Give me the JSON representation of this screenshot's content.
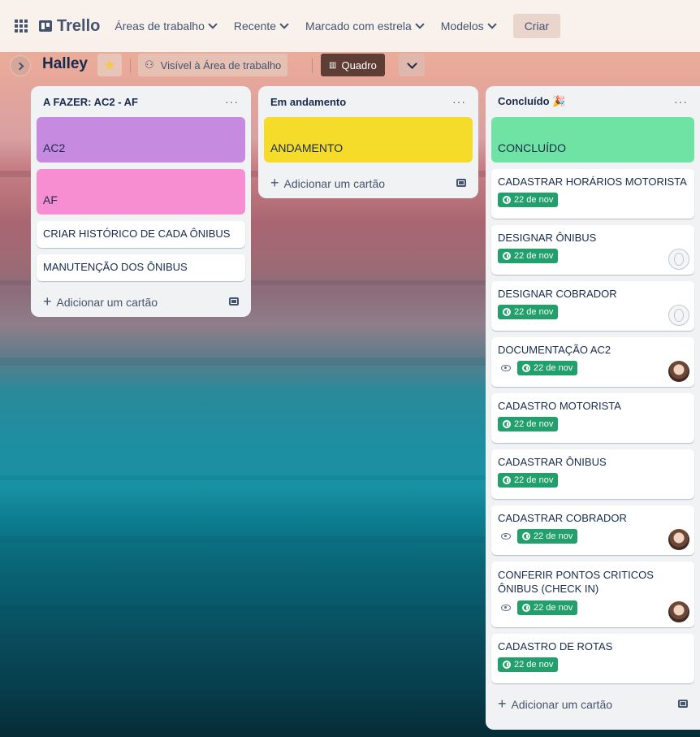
{
  "topbar": {
    "logo": "Trello",
    "nav": [
      "Áreas de trabalho",
      "Recente",
      "Marcado com estrela",
      "Modelos"
    ],
    "create_label": "Criar"
  },
  "board": {
    "title": "Halley",
    "visibility_label": "Visível à Área de trabalho",
    "view_label": "Quadro"
  },
  "lists": [
    {
      "title": "A FAZER: AC2 - AF",
      "cover_cards": [
        {
          "title": "AC2",
          "color": "#c68ae0"
        },
        {
          "title": "AF",
          "color": "#f78ed1"
        }
      ],
      "cards": [
        {
          "title": "CRIAR HISTÓRICO DE CADA ÔNIBUS"
        },
        {
          "title": "MANUTENÇÃO DOS ÔNIBUS"
        }
      ],
      "add_label": "Adicionar um cartão"
    },
    {
      "title": "Em andamento",
      "cover_cards": [
        {
          "title": "ANDAMENTO",
          "color": "#f5dc2a"
        }
      ],
      "cards": [],
      "add_label": "Adicionar um cartão"
    },
    {
      "title": "Concluído 🎉",
      "cover_cards": [
        {
          "title": "CONCLUÍDO",
          "color": "#6fe3a3"
        }
      ],
      "cards": [
        {
          "title": "CADASTRAR HORÁRIOS MOTORISTA",
          "date": "22 de nov",
          "watch": false,
          "avatar": "none"
        },
        {
          "title": "DESIGNAR ÔNIBUS",
          "date": "22 de nov",
          "watch": false,
          "avatar": "empty"
        },
        {
          "title": "DESIGNAR COBRADOR",
          "date": "22 de nov",
          "watch": false,
          "avatar": "empty"
        },
        {
          "title": "DOCUMENTAÇÃO AC2",
          "date": "22 de nov",
          "watch": true,
          "avatar": "photo"
        },
        {
          "title": "CADASTRO MOTORISTA",
          "date": "22 de nov",
          "watch": false,
          "avatar": "none"
        },
        {
          "title": "CADASTRAR ÔNIBUS",
          "date": "22 de nov",
          "watch": false,
          "avatar": "none"
        },
        {
          "title": "CADASTRAR COBRADOR",
          "date": "22 de nov",
          "watch": true,
          "avatar": "photo"
        },
        {
          "title": "CONFERIR PONTOS CRITICOS ÔNIBUS (CHECK IN)",
          "date": "22 de nov",
          "watch": true,
          "avatar": "photo"
        },
        {
          "title": "CADASTRO DE ROTAS",
          "date": "22 de nov",
          "watch": false,
          "avatar": "none"
        }
      ],
      "add_label": "Adicionar um cartão"
    }
  ]
}
